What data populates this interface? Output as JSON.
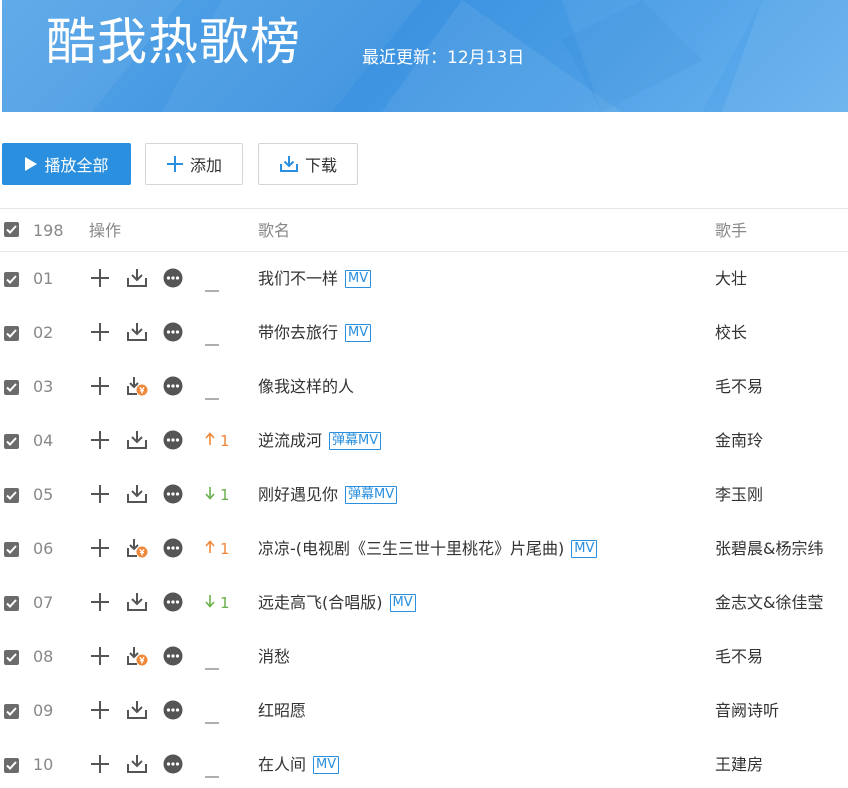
{
  "header": {
    "title": "酷我热歌榜",
    "update_text": "最近更新：12月13日"
  },
  "toolbar": {
    "play_all_label": "播放全部",
    "add_label": "添加",
    "download_label": "下载"
  },
  "table": {
    "count": "198",
    "col_ops": "操作",
    "col_song": "歌名",
    "col_artist": "歌手"
  },
  "colors": {
    "accent": "#2a8fde",
    "trend_up": "#f0883a",
    "trend_down": "#6ab04c"
  },
  "songs": [
    {
      "rank": "01",
      "title": "我们不一样",
      "badge": "MV",
      "artist": "大壮",
      "trend": "same",
      "trend_value": "",
      "paid": false
    },
    {
      "rank": "02",
      "title": "带你去旅行",
      "badge": "MV",
      "artist": "校长",
      "trend": "same",
      "trend_value": "",
      "paid": false
    },
    {
      "rank": "03",
      "title": "像我这样的人",
      "badge": "",
      "artist": "毛不易",
      "trend": "same",
      "trend_value": "",
      "paid": true
    },
    {
      "rank": "04",
      "title": "逆流成河",
      "badge": "弹幕MV",
      "artist": "金南玲",
      "trend": "up",
      "trend_value": "1",
      "paid": false
    },
    {
      "rank": "05",
      "title": "刚好遇见你",
      "badge": "弹幕MV",
      "artist": "李玉刚",
      "trend": "down",
      "trend_value": "1",
      "paid": false
    },
    {
      "rank": "06",
      "title": "凉凉-(电视剧《三生三世十里桃花》片尾曲)",
      "badge": "MV",
      "artist": "张碧晨&杨宗纬",
      "trend": "up",
      "trend_value": "1",
      "paid": true
    },
    {
      "rank": "07",
      "title": "远走高飞(合唱版)",
      "badge": "MV",
      "artist": "金志文&徐佳莹",
      "trend": "down",
      "trend_value": "1",
      "paid": false
    },
    {
      "rank": "08",
      "title": "消愁",
      "badge": "",
      "artist": "毛不易",
      "trend": "same",
      "trend_value": "",
      "paid": true
    },
    {
      "rank": "09",
      "title": "红昭愿",
      "badge": "",
      "artist": "音阙诗听",
      "trend": "same",
      "trend_value": "",
      "paid": false
    },
    {
      "rank": "10",
      "title": "在人间",
      "badge": "MV",
      "artist": "王建房",
      "trend": "same",
      "trend_value": "",
      "paid": false
    }
  ]
}
